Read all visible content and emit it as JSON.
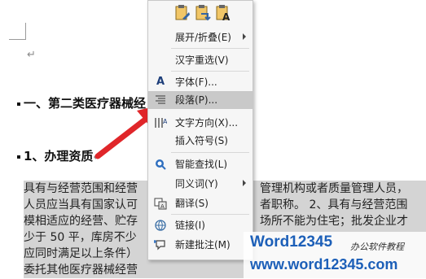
{
  "document": {
    "heading1": "一、第二类医疗器械经",
    "heading2": "1、办理资质",
    "body_lines": [
      "具有与经营范围和经营",
      "人员应当具有国家认可",
      "模相适应的经营、贮存",
      "少于 50 平，库房不少",
      "应同时满足以上条件）",
      "委托其他医疗器械经营"
    ],
    "body_lines_right": [
      "管理机构或者质量管理人员，",
      "者职称。  2、具有与经营范围",
      "场所不能为住宅；批发企业才",
      "",
      "",
      ""
    ]
  },
  "menu": {
    "items": [
      {
        "label": "展开/折叠(E)",
        "icon": "",
        "submenu": true
      },
      {
        "label": "汉字重选(V)",
        "icon": "",
        "submenu": false
      },
      {
        "label": "字体(F)...",
        "icon": "A",
        "submenu": false
      },
      {
        "label": "段落(P)...",
        "icon": "paragraph-icon",
        "submenu": false,
        "highlighted": true
      },
      {
        "label": "文字方向(X)...",
        "icon": "text-direction-icon",
        "submenu": false
      },
      {
        "label": "插入符号(S)",
        "icon": "",
        "submenu": false
      },
      {
        "label": "智能查找(L)",
        "icon": "smart-lookup-icon",
        "submenu": false
      },
      {
        "label": "同义词(Y)",
        "icon": "",
        "submenu": true
      },
      {
        "label": "翻译(S)",
        "icon": "translate-icon",
        "submenu": false
      },
      {
        "label": "链接(I)",
        "icon": "link-icon",
        "submenu": false
      },
      {
        "label": "新建批注(M)",
        "icon": "new-comment-icon",
        "submenu": false
      }
    ],
    "toolbar_icons": [
      "paste-keep-formatting-icon",
      "paste-merge-icon",
      "paste-text-only-icon"
    ]
  },
  "watermark": {
    "brand": "Word12345",
    "subtitle": "办公软件教程",
    "url": "www.word12345.com"
  },
  "colors": {
    "arrow": "#e0262a",
    "selection": "#d4d4d4",
    "menu_hover": "#c9c9c9",
    "watermark_blue": "#1c5fb8"
  }
}
